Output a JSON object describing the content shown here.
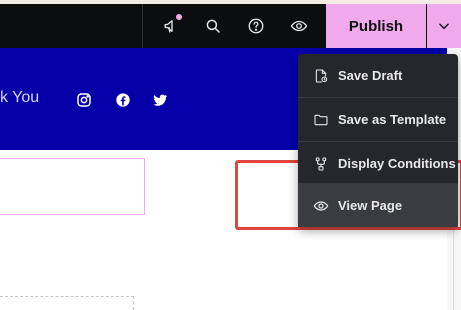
{
  "toolbar": {
    "publish_label": "Publish",
    "icons": [
      "megaphone-icon",
      "search-icon",
      "help-icon",
      "eye-icon",
      "chevron-down-icon"
    ]
  },
  "canvas": {
    "band_text": "k You",
    "social_icons": [
      "instagram-icon",
      "facebook-icon",
      "twitter-icon"
    ]
  },
  "menu": {
    "items": [
      {
        "label": "Save Draft",
        "icon": "file-clock-icon"
      },
      {
        "label": "Save as Template",
        "icon": "folder-icon"
      },
      {
        "label": "Display Conditions",
        "icon": "conditions-icon"
      },
      {
        "label": "View Page",
        "icon": "eye-icon"
      }
    ]
  },
  "colors": {
    "topbar": "#0c0d0e",
    "publish_accent": "#f1a9ee",
    "band_blue": "#0500a8",
    "menu_bg": "#26272a",
    "highlight": "#e0463e"
  }
}
